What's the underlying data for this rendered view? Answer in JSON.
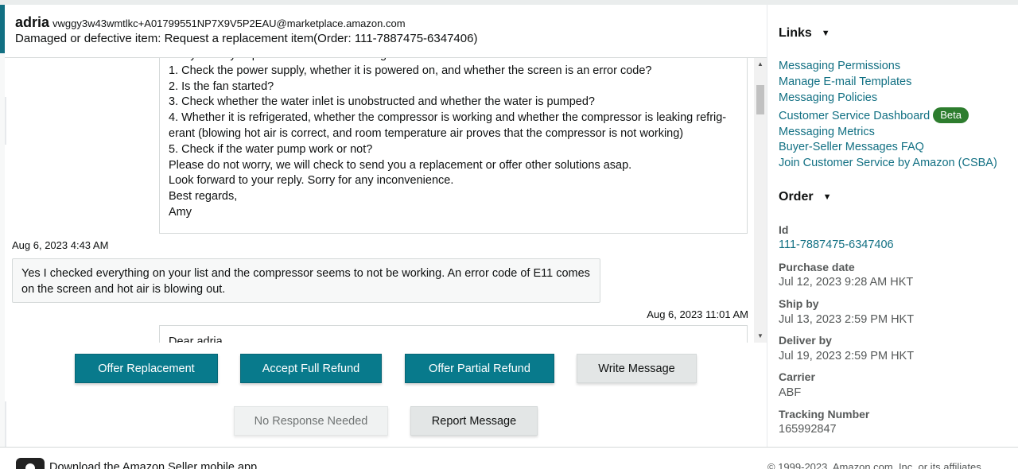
{
  "header": {
    "buyer_name": "adria",
    "buyer_email": "vwggy3w43wmtlkc+A01799551NP7X9V5P2EAU@marketplace.amazon.com",
    "subject": "Damaged or defective item: Request a replacement item(Order: 111-7887475-6347406)"
  },
  "thread": {
    "seller_message_1": "Sorry could you please check the following and let us know the result?\n1. Check the power supply, whether it is powered on, and whether the screen is an error code?\n2. Is the fan started?\n3. Check whether the water inlet is unobstructed and whether the water is pumped?\n4. Whether it is refrigerated, whether the compressor is working and whether the compressor is leaking refrig-\nerant (blowing hot air is correct, and room temperature air proves that the compressor is not working)\n5. Check if the water pump work or not?\nPlease do not worry, we will check to send you a replacement or offer other solutions asap.\nLook forward to your reply. Sorry for any inconvenience.\nBest regards,\nAmy",
    "buyer_timestamp": "Aug 6, 2023 4:43 AM",
    "buyer_message": "Yes I checked everything on your list and the compressor seems to not be working. An error code of E11 comes on the screen and hot air is blowing out.",
    "seller_timestamp_2": "Aug 6, 2023 11:01 AM",
    "seller_message_2": "Dear adria,"
  },
  "actions": {
    "offer_replacement": "Offer Replacement",
    "accept_full_refund": "Accept Full Refund",
    "offer_partial_refund": "Offer Partial Refund",
    "write_message": "Write Message",
    "no_response_needed": "No Response Needed",
    "report_message": "Report Message"
  },
  "sidebar": {
    "links_heading": "Links",
    "links": [
      "Messaging Permissions",
      "Manage E-mail Templates",
      "Messaging Policies",
      "Customer Service Dashboard",
      "Messaging Metrics",
      "Buyer-Seller Messages FAQ",
      "Join Customer Service by Amazon (CSBA)"
    ],
    "beta_badge": "Beta",
    "order_heading": "Order",
    "order": {
      "id_label": "Id",
      "id_value": "111-7887475-6347406",
      "purchase_label": "Purchase date",
      "purchase_value": "Jul 12, 2023 9:28 AM HKT",
      "ship_label": "Ship by",
      "ship_value": "Jul 13, 2023 2:59 PM HKT",
      "deliver_label": "Deliver by",
      "deliver_value": "Jul 19, 2023 2:59 PM HKT",
      "carrier_label": "Carrier",
      "carrier_value": "ABF",
      "tracking_label": "Tracking Number",
      "tracking_value": "165992847"
    }
  },
  "footer": {
    "app_text": "Download the Amazon Seller mobile app",
    "copyright": "© 1999-2023, Amazon.com, Inc. or its affiliates"
  },
  "colors": {
    "primary_button": "#087a8c",
    "link": "#127083",
    "beta_badge": "#2d7d2e"
  }
}
